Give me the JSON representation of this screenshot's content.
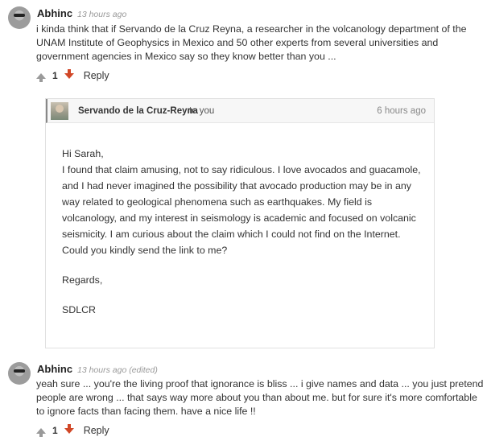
{
  "comment1": {
    "author": "Abhinc",
    "time": "13 hours ago",
    "text": "i kinda think that if Servando de la Cruz Reyna, a researcher in the volcanology department of the UNAM Institute of Geophysics in Mexico and 50 other experts from several universities and government agencies in Mexico say so they know better than you ...",
    "votes": "1",
    "reply_label": "Reply"
  },
  "message": {
    "author": "Servando de la Cruz-Reyna",
    "to": "to you",
    "time": "6 hours ago",
    "greeting": "Hi Sarah,",
    "paragraph": "I found that claim amusing, not to say ridiculous. I love avocados and guacamole, and I had never imagined the possibility that avocado production may be in any way related to geological phenomena such as earthquakes. My field is volcanology, and my interest in seismology is academic and focused on volcanic seismicity. I am curious about the claim which I could not find on the Internet. Could you kindly send the link to me?",
    "closing": "Regards,",
    "signature": "SDLCR"
  },
  "comment2": {
    "author": "Abhinc",
    "time": "13 hours ago (edited)",
    "text": "yeah sure ... you're the living proof that ignorance is bliss ... i give names and data ... you just pretend people are wrong ... that says way more about you than about me. but for sure it's more comfortable to ignore facts than facing them. have a nice life !!",
    "votes": "1",
    "reply_label": "Reply"
  }
}
